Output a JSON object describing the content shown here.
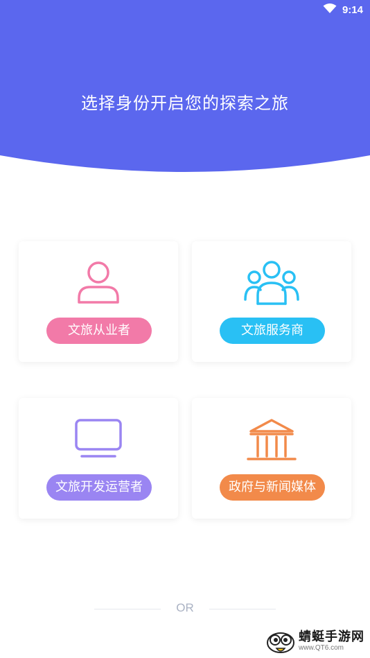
{
  "status_bar": {
    "time": "9:14",
    "wifi_icon": "wifi-icon"
  },
  "header": {
    "title": "选择身份开启您的探索之旅",
    "color": "#5b67ee"
  },
  "cards": [
    {
      "label": "文旅从业者",
      "icon": "person-icon",
      "color": "#f27aa8"
    },
    {
      "label": "文旅服务商",
      "icon": "group-icon",
      "color": "#29c0f4"
    },
    {
      "label": "文旅开发运营者",
      "icon": "monitor-icon",
      "color": "#9a85f2"
    },
    {
      "label": "政府与新闻媒体",
      "icon": "government-building-icon",
      "color": "#f28a4a"
    }
  ],
  "divider": {
    "text": "OR"
  },
  "watermark": {
    "name": "蜻蜓手游网",
    "url": "www.QT6.com"
  }
}
